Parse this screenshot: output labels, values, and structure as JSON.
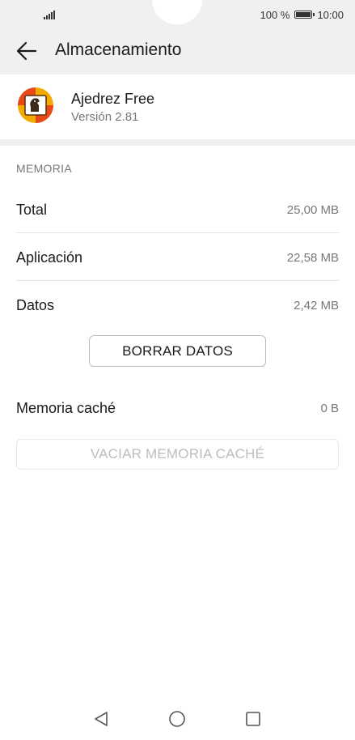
{
  "status_bar": {
    "battery_percent": "100 %",
    "time": "10:00"
  },
  "header": {
    "title": "Almacenamiento"
  },
  "app": {
    "name": "Ajedrez Free",
    "version": "Versión 2.81"
  },
  "memory": {
    "section_label": "MEMORIA",
    "rows": [
      {
        "label": "Total",
        "value": "25,00 MB"
      },
      {
        "label": "Aplicación",
        "value": "22,58 MB"
      },
      {
        "label": "Datos",
        "value": "2,42 MB"
      }
    ],
    "clear_data_button": "BORRAR DATOS",
    "cache": {
      "label": "Memoria caché",
      "value": "0 B"
    },
    "clear_cache_button": "VACIAR MEMORIA CACHÉ"
  },
  "icons": {
    "back": "arrow-left-icon",
    "app": "chess-app-icon",
    "nav_back": "triangle-back-icon",
    "nav_home": "circle-home-icon",
    "nav_recents": "square-recents-icon"
  }
}
